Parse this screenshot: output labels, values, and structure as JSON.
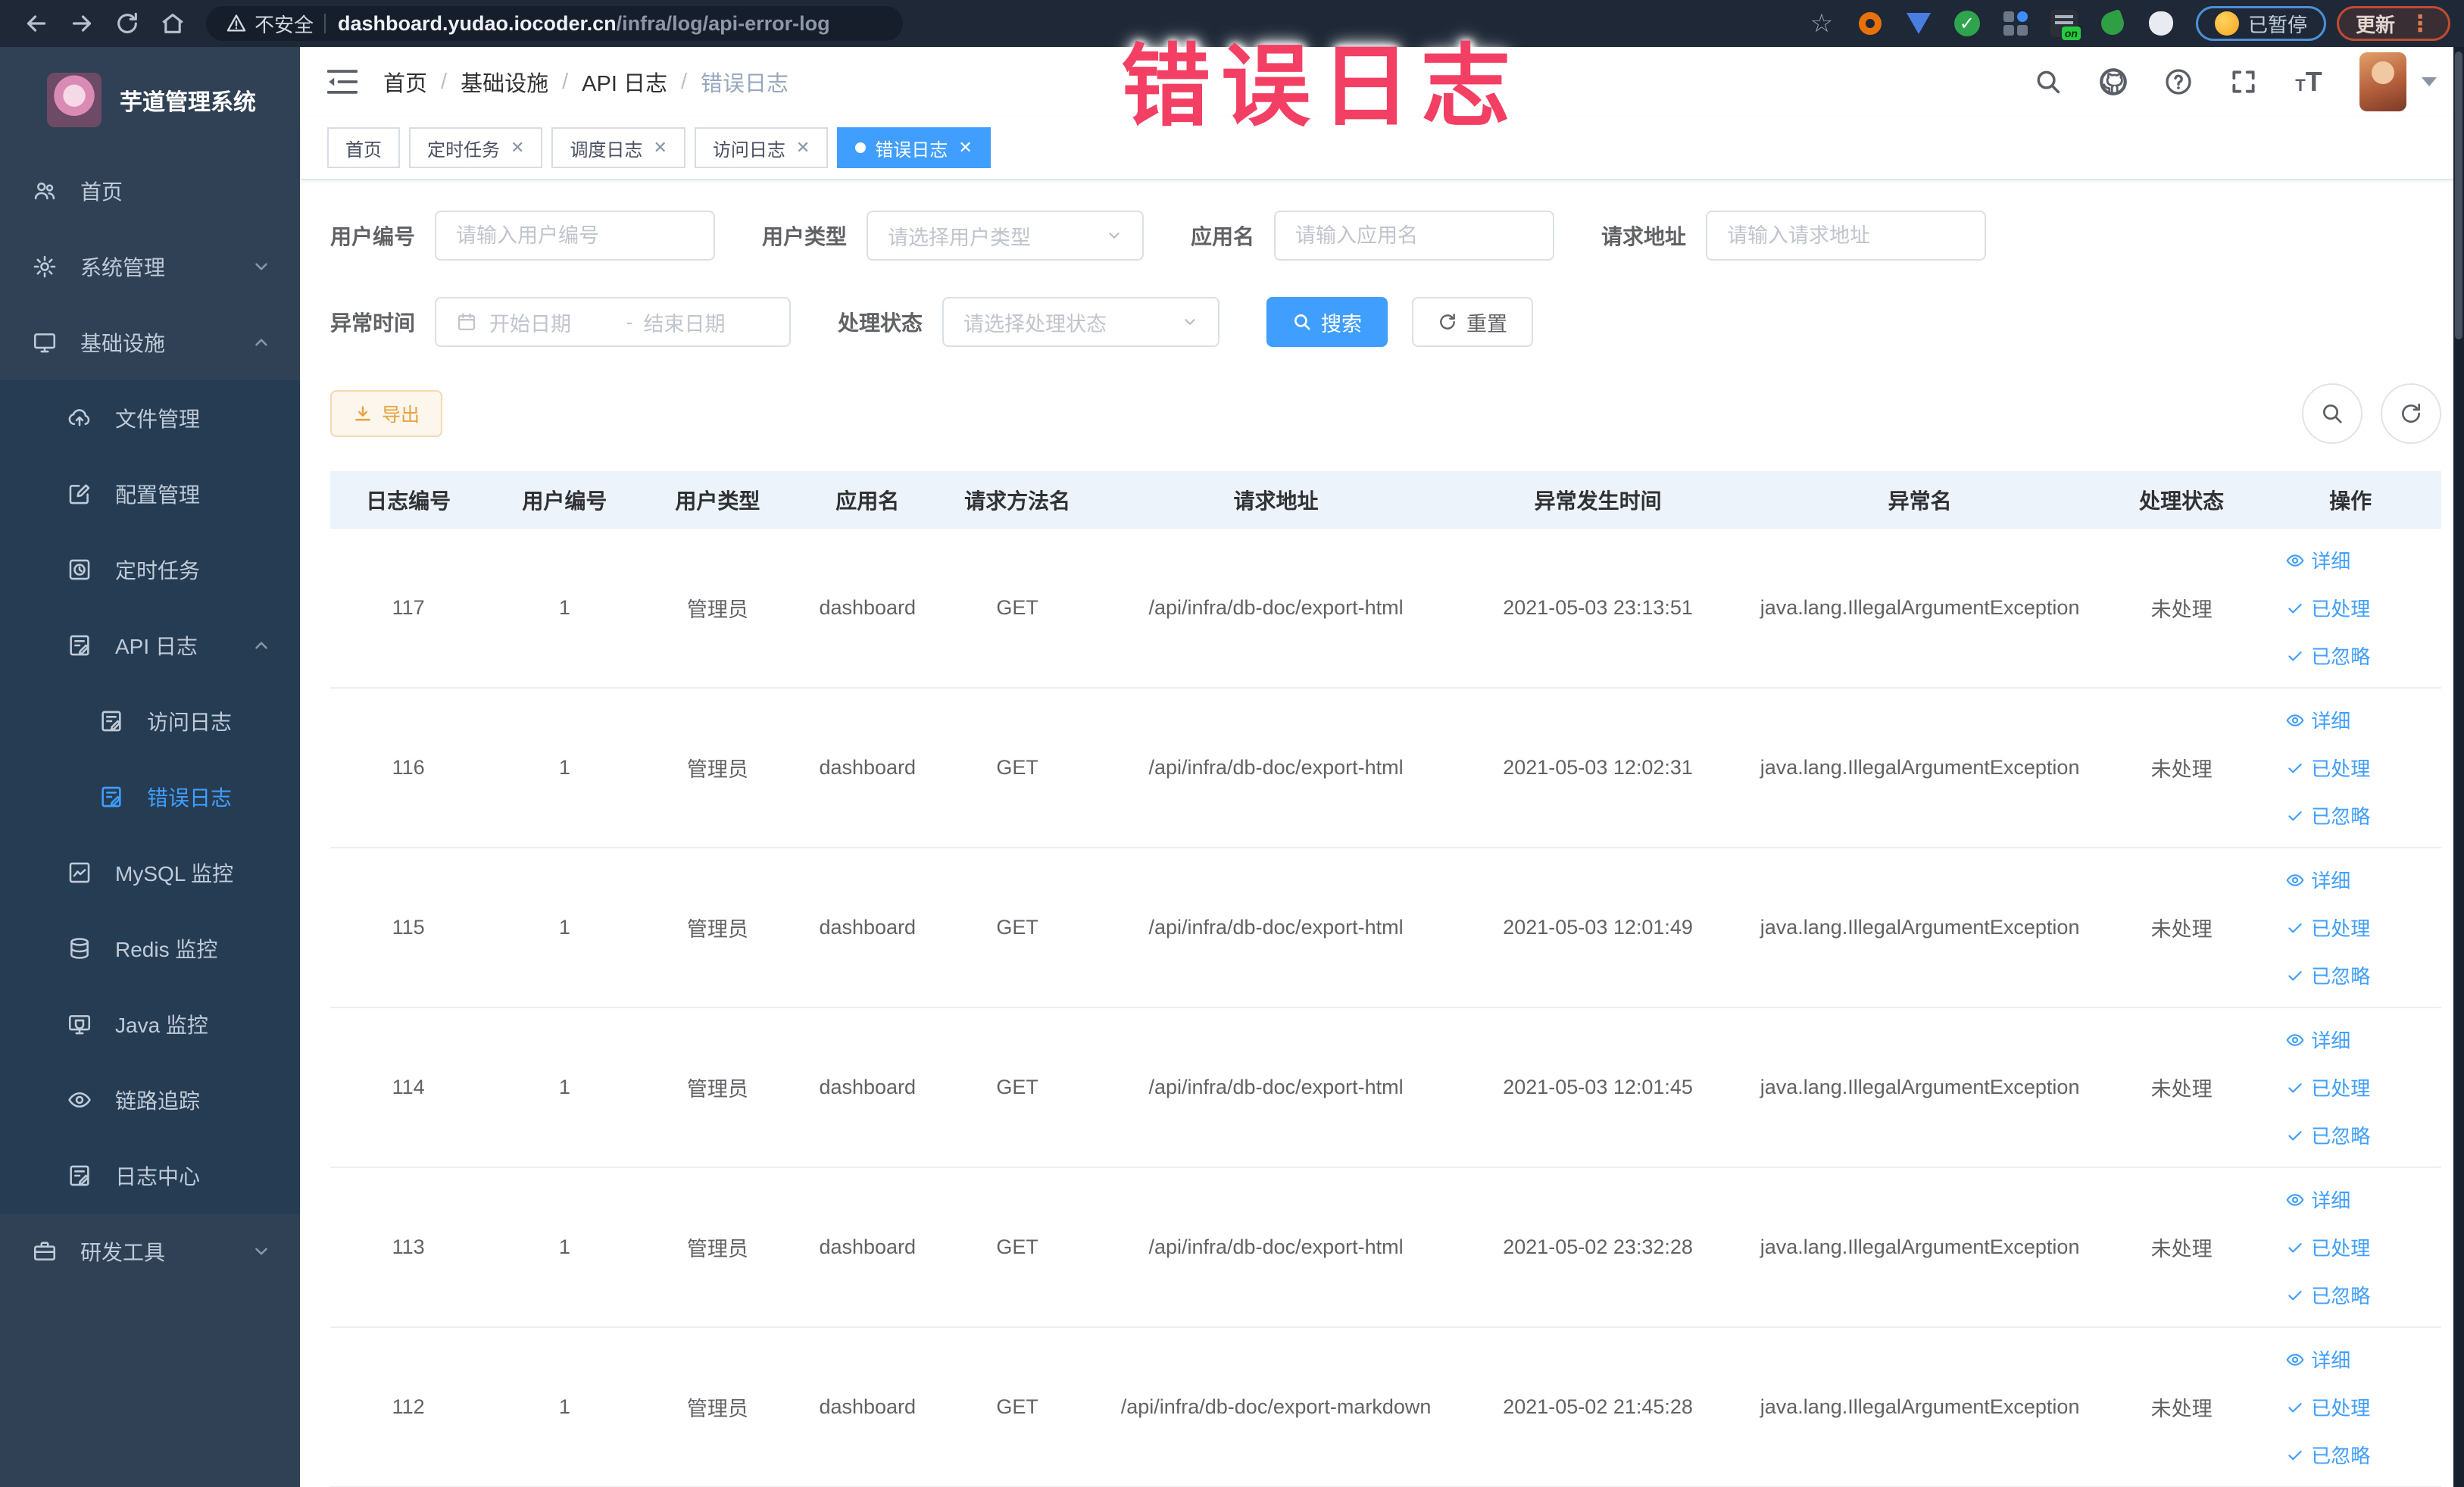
{
  "browser": {
    "security_label": "不安全",
    "url_host": "dashboard.yudao.iocoder.cn",
    "url_path": "/infra/log/api-error-log",
    "paused_badge": "已暂停",
    "update_button": "更新",
    "menu_dots": "⋮"
  },
  "overlay": {
    "title": "错误日志",
    "color": "#f23f63"
  },
  "sidebar": {
    "app_title": "芋道管理系统",
    "items": [
      {
        "label": "首页",
        "icon": "people",
        "level": 0
      },
      {
        "label": "系统管理",
        "icon": "gear",
        "level": 0,
        "chevron": "down"
      },
      {
        "label": "基础设施",
        "icon": "monitor",
        "level": 0,
        "chevron": "up"
      },
      {
        "label": "文件管理",
        "icon": "upload",
        "level": 1
      },
      {
        "label": "配置管理",
        "icon": "edit",
        "level": 1
      },
      {
        "label": "定时任务",
        "icon": "timer",
        "level": 1
      },
      {
        "label": "API 日志",
        "icon": "log",
        "level": 1,
        "chevron": "up"
      },
      {
        "label": "访问日志",
        "icon": "log",
        "level": 2
      },
      {
        "label": "错误日志",
        "icon": "log",
        "level": 2,
        "active": true
      },
      {
        "label": "MySQL 监控",
        "icon": "chart",
        "level": 1
      },
      {
        "label": "Redis 监控",
        "icon": "redis",
        "level": 1
      },
      {
        "label": "Java 监控",
        "icon": "java",
        "level": 1
      },
      {
        "label": "链路追踪",
        "icon": "eye",
        "level": 1
      },
      {
        "label": "日志中心",
        "icon": "log",
        "level": 1
      },
      {
        "label": "研发工具",
        "icon": "tool",
        "level": 0,
        "chevron": "down"
      }
    ]
  },
  "breadcrumb": {
    "items": [
      "首页",
      "基础设施",
      "API 日志",
      "错误日志"
    ]
  },
  "tabs": [
    {
      "label": "首页",
      "closable": false,
      "active": false
    },
    {
      "label": "定时任务",
      "closable": true,
      "active": false
    },
    {
      "label": "调度日志",
      "closable": true,
      "active": false
    },
    {
      "label": "访问日志",
      "closable": true,
      "active": false
    },
    {
      "label": "错误日志",
      "closable": true,
      "active": true
    }
  ],
  "filters": {
    "user_id": {
      "label": "用户编号",
      "placeholder": "请输入用户编号"
    },
    "user_type": {
      "label": "用户类型",
      "placeholder": "请选择用户类型"
    },
    "app_name": {
      "label": "应用名",
      "placeholder": "请输入应用名"
    },
    "request_url": {
      "label": "请求地址",
      "placeholder": "请输入请求地址"
    },
    "exception_time": {
      "label": "异常时间",
      "start_placeholder": "开始日期",
      "separator": "-",
      "end_placeholder": "结束日期"
    },
    "process_status": {
      "label": "处理状态",
      "placeholder": "请选择处理状态"
    },
    "search_label": "搜索",
    "reset_label": "重置"
  },
  "toolbar": {
    "export_label": "导出"
  },
  "table": {
    "columns": [
      "日志编号",
      "用户编号",
      "用户类型",
      "应用名",
      "请求方法名",
      "请求地址",
      "异常发生时间",
      "异常名",
      "处理状态",
      "操作"
    ],
    "row_actions": [
      "详细",
      "已处理",
      "已忽略"
    ],
    "rows": [
      {
        "id": "117",
        "user_id": "1",
        "user_type": "管理员",
        "app": "dashboard",
        "method": "GET",
        "url": "/api/infra/db-doc/export-html",
        "time": "2021-05-03 23:13:51",
        "exception": "java.lang.IllegalArgumentException",
        "status": "未处理"
      },
      {
        "id": "116",
        "user_id": "1",
        "user_type": "管理员",
        "app": "dashboard",
        "method": "GET",
        "url": "/api/infra/db-doc/export-html",
        "time": "2021-05-03 12:02:31",
        "exception": "java.lang.IllegalArgumentException",
        "status": "未处理"
      },
      {
        "id": "115",
        "user_id": "1",
        "user_type": "管理员",
        "app": "dashboard",
        "method": "GET",
        "url": "/api/infra/db-doc/export-html",
        "time": "2021-05-03 12:01:49",
        "exception": "java.lang.IllegalArgumentException",
        "status": "未处理"
      },
      {
        "id": "114",
        "user_id": "1",
        "user_type": "管理员",
        "app": "dashboard",
        "method": "GET",
        "url": "/api/infra/db-doc/export-html",
        "time": "2021-05-03 12:01:45",
        "exception": "java.lang.IllegalArgumentException",
        "status": "未处理"
      },
      {
        "id": "113",
        "user_id": "1",
        "user_type": "管理员",
        "app": "dashboard",
        "method": "GET",
        "url": "/api/infra/db-doc/export-html",
        "time": "2021-05-02 23:32:28",
        "exception": "java.lang.IllegalArgumentException",
        "status": "未处理"
      },
      {
        "id": "112",
        "user_id": "1",
        "user_type": "管理员",
        "app": "dashboard",
        "method": "GET",
        "url": "/api/infra/db-doc/export-markdown",
        "time": "2021-05-02 21:45:28",
        "exception": "java.lang.IllegalArgumentException",
        "status": "未处理"
      }
    ]
  }
}
